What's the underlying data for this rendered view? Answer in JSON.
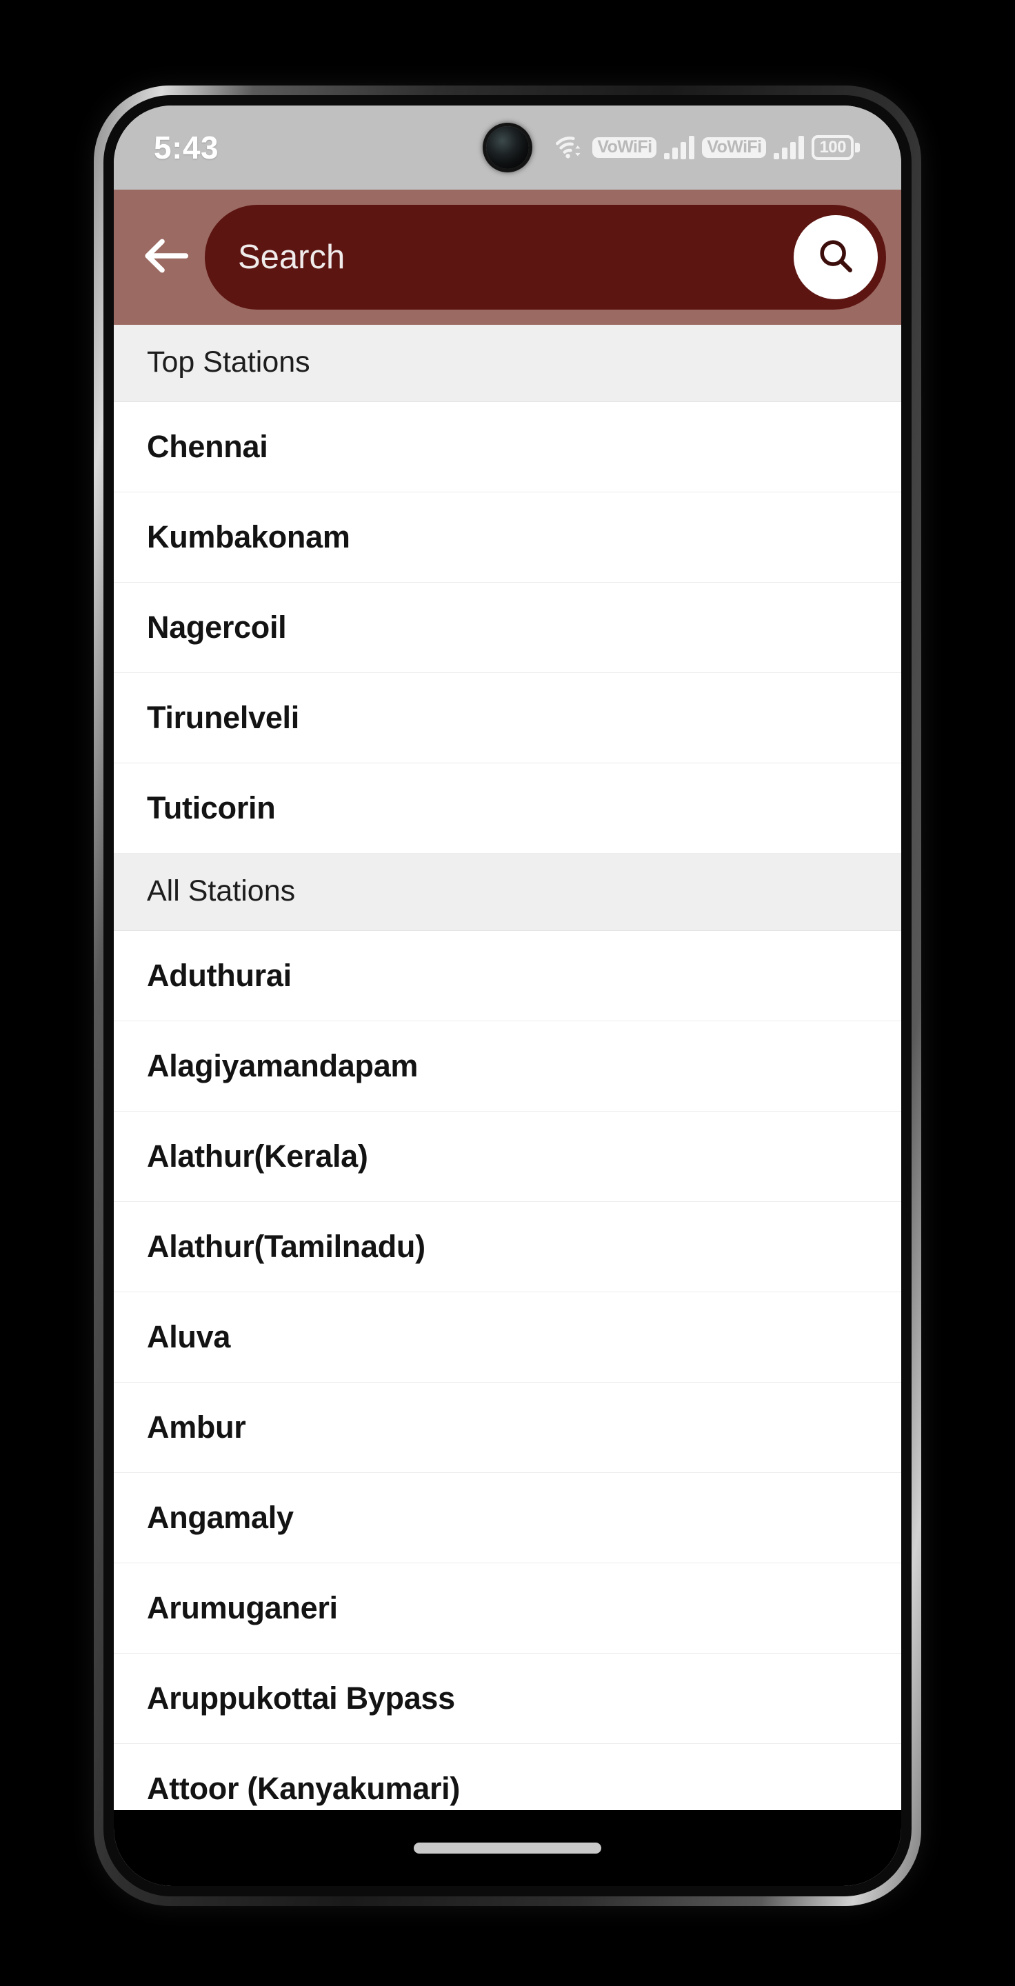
{
  "status_bar": {
    "time": "5:43",
    "wifi_icon": "wifi-icon",
    "vowifi_label_1": "VoWiFi",
    "vowifi_label_2": "VoWiFi",
    "battery_level": "100"
  },
  "app_bar": {
    "back_icon": "back-arrow-icon",
    "search_placeholder": "Search",
    "search_value": "",
    "search_icon": "search-icon",
    "bar_color": "#9b6a62",
    "field_color": "#5d1512"
  },
  "sections": [
    {
      "header": "Top Stations",
      "stations": [
        "Chennai",
        "Kumbakonam",
        "Nagercoil",
        "Tirunelveli",
        "Tuticorin"
      ]
    },
    {
      "header": "All Stations",
      "stations": [
        "Aduthurai",
        "Alagiyamandapam",
        "Alathur(Kerala)",
        "Alathur(Tamilnadu)",
        "Aluva",
        "Ambur",
        "Angamaly",
        "Arumuganeri",
        "Aruppukottai Bypass",
        "Attoor (Kanyakumari)"
      ]
    }
  ],
  "nav_bar": {
    "gesture_handle": "gesture-handle"
  }
}
